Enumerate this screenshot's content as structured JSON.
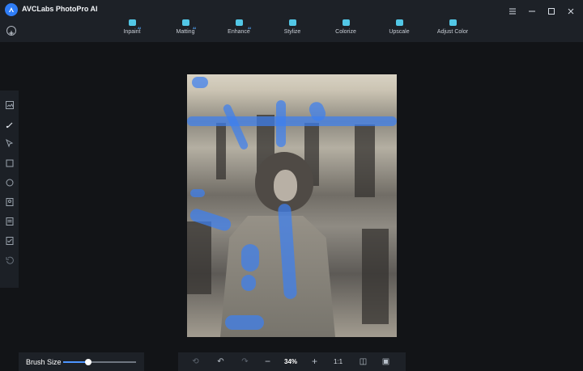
{
  "app": {
    "title": "AVCLabs PhotoPro AI"
  },
  "tabs": [
    {
      "label": "Inpaint",
      "badge": "AI"
    },
    {
      "label": "Matting",
      "badge": "AI"
    },
    {
      "label": "Enhance",
      "badge": "AI"
    },
    {
      "label": "Stylize",
      "badge": ""
    },
    {
      "label": "Colorize",
      "badge": ""
    },
    {
      "label": "Upscale",
      "badge": ""
    },
    {
      "label": "Adjust Color",
      "badge": ""
    }
  ],
  "left_tools": [
    {
      "icon": "image-icon"
    },
    {
      "icon": "brush-icon"
    },
    {
      "icon": "cursor-icon"
    },
    {
      "icon": "rectangle-icon"
    },
    {
      "icon": "ellipse-icon"
    },
    {
      "icon": "portrait-icon"
    },
    {
      "icon": "document-icon"
    },
    {
      "icon": "select-icon"
    },
    {
      "icon": "history-icon"
    }
  ],
  "brush": {
    "label": "Brush Size",
    "value_fraction": 0.34
  },
  "zoom": {
    "label": "34%"
  },
  "bottom_toolbar": {
    "one_to_one": "1:1"
  },
  "colors": {
    "accent": "#3d7ff0",
    "badge": "#53a9ff",
    "toolbar": "#1d2127",
    "background": "#121417"
  }
}
